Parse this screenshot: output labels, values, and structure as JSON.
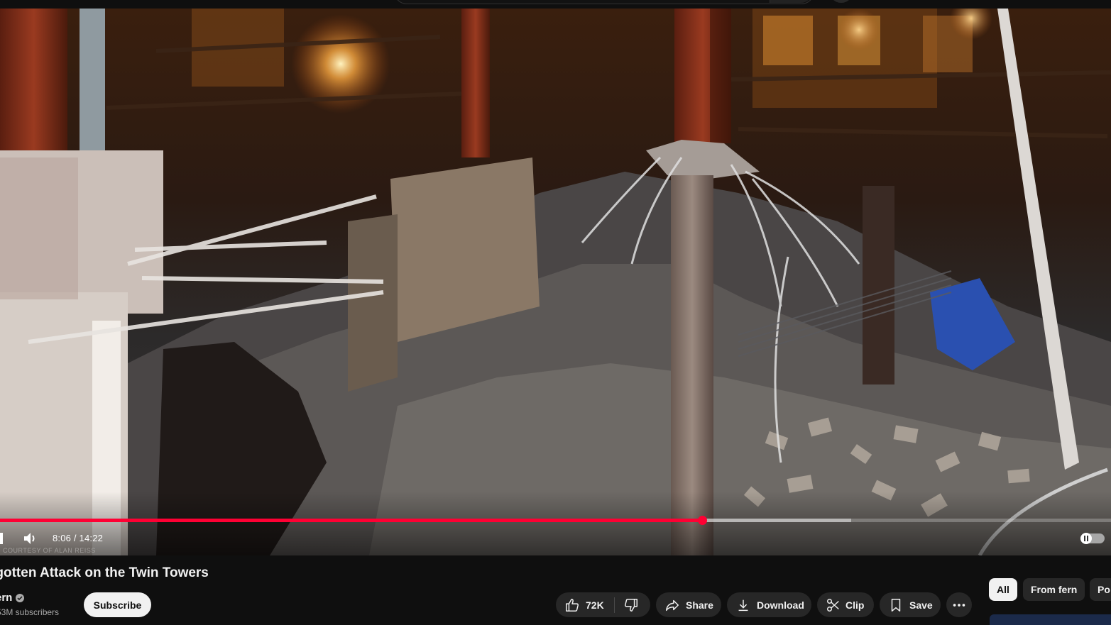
{
  "player": {
    "current_time": "8:06",
    "duration": "14:22",
    "time_display": "8:06 / 14:22",
    "progress_fraction": 0.632,
    "buffered_fraction": 0.766,
    "credit": "COURTESY OF ALAN REISS"
  },
  "video": {
    "title": "rgotten Attack on the Twin Towers"
  },
  "channel": {
    "name": "ern",
    "subscribers": "53M subscribers",
    "subscribe_label": "Subscribe"
  },
  "actions": {
    "like_count": "72K",
    "share_label": "Share",
    "download_label": "Download",
    "clip_label": "Clip",
    "save_label": "Save"
  },
  "chips": [
    {
      "label": "All",
      "active": true
    },
    {
      "label": "From fern",
      "active": false
    },
    {
      "label": "Po",
      "active": false
    }
  ],
  "colors": {
    "accent": "#ff0033",
    "background": "#0f0f0f",
    "pill": "#272727"
  }
}
